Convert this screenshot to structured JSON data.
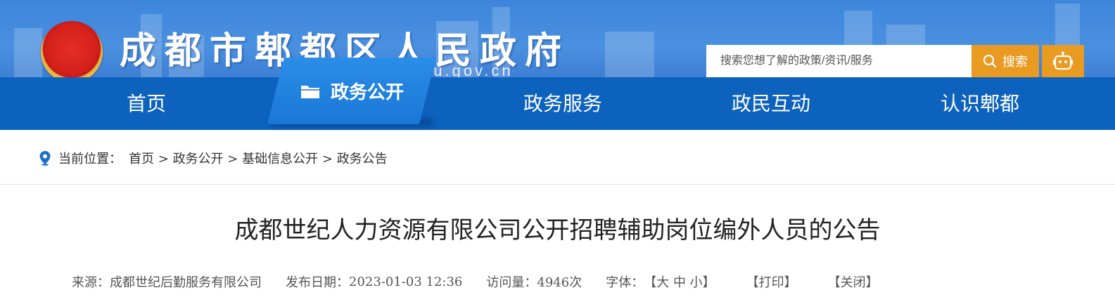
{
  "header": {
    "site_title": "成都市郫都区人民政府",
    "domain_hint": "du.gov.cn",
    "search": {
      "placeholder": "搜索您想了解的政策/资讯/服务",
      "button_label": "搜索"
    },
    "colors": {
      "banner": "#4a90e0",
      "nav": "#0d62bd",
      "accent": "#e99a20"
    }
  },
  "nav": {
    "items": [
      "首页",
      "政务公开",
      "政务服务",
      "政民互动",
      "认识郫都"
    ],
    "active": "政务公开"
  },
  "breadcrumb": {
    "label": "当前位置：",
    "path": [
      "首页",
      "政务公开",
      "基础信息公开",
      "政务公告"
    ],
    "separator": ">"
  },
  "article": {
    "title": "成都世纪人力资源有限公司公开招聘辅助岗位编外人员的公告",
    "source_label": "来源：",
    "source": "成都世纪后勤服务有限公司",
    "date_label": "发布日期：",
    "date": "2023-01-03 12:36",
    "views_label": "访问量：",
    "views": "4946次",
    "font_label": "字体：",
    "font_large": "大",
    "font_medium": "中",
    "font_small": "小",
    "print": "打印",
    "close": "关闭"
  }
}
